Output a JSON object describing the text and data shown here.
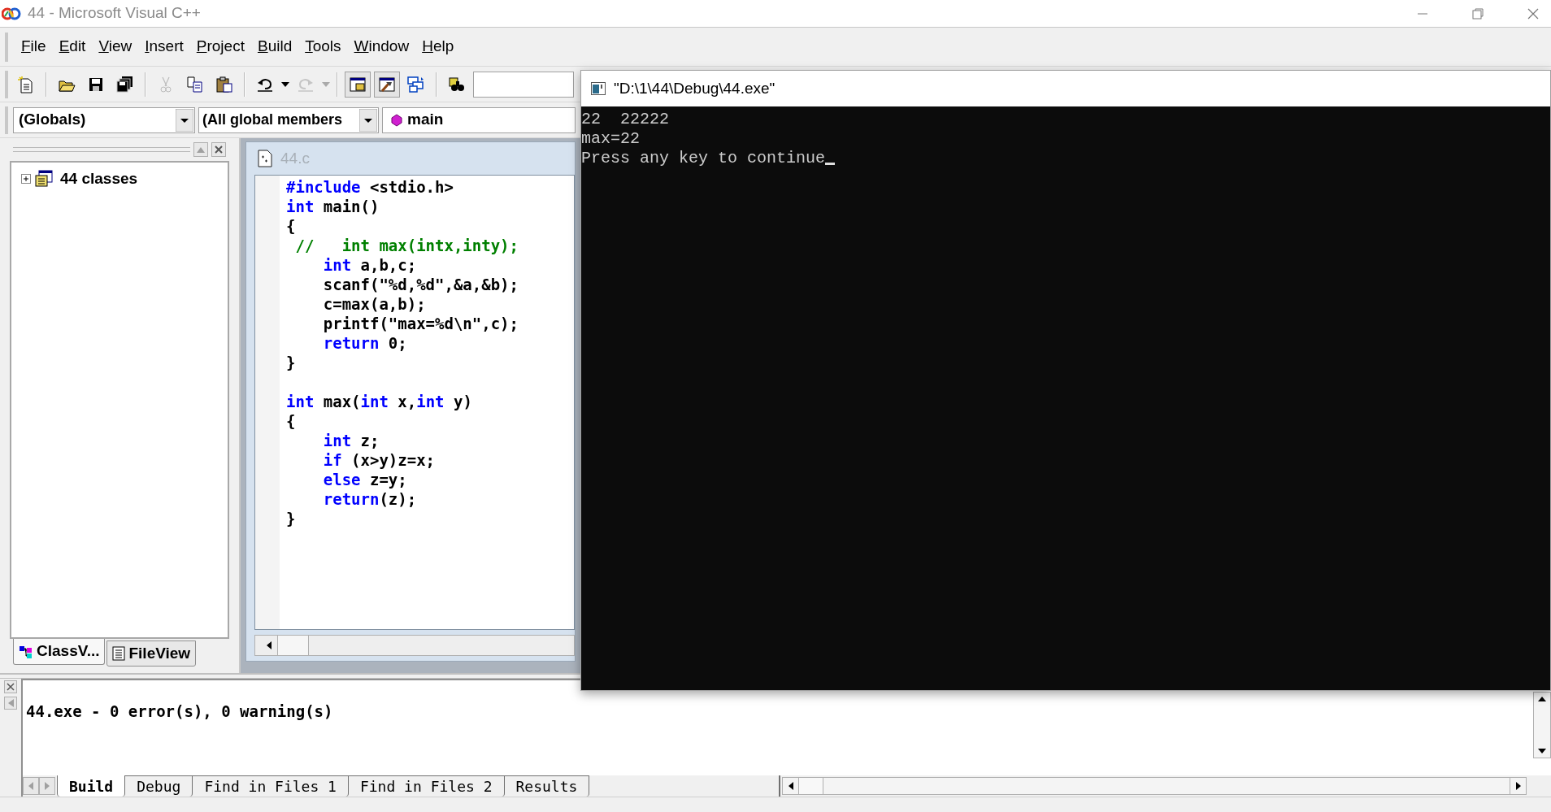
{
  "window": {
    "title": "44 - Microsoft Visual C++"
  },
  "menu": [
    {
      "label": "File"
    },
    {
      "label": "Edit"
    },
    {
      "label": "View"
    },
    {
      "label": "Insert"
    },
    {
      "label": "Project"
    },
    {
      "label": "Build"
    },
    {
      "label": "Tools"
    },
    {
      "label": "Window"
    },
    {
      "label": "Help"
    }
  ],
  "toolbar": [
    {
      "kind": "new",
      "disabled": false,
      "pressed": false
    },
    {
      "kind": "sep"
    },
    {
      "kind": "open",
      "disabled": false,
      "pressed": false
    },
    {
      "kind": "save",
      "disabled": false,
      "pressed": false
    },
    {
      "kind": "save_all",
      "disabled": false,
      "pressed": false
    },
    {
      "kind": "sep"
    },
    {
      "kind": "cut",
      "disabled": true,
      "pressed": false
    },
    {
      "kind": "copy",
      "disabled": false,
      "pressed": false
    },
    {
      "kind": "paste",
      "disabled": false,
      "pressed": false
    },
    {
      "kind": "sep"
    },
    {
      "kind": "undo",
      "disabled": false,
      "pressed": false
    },
    {
      "kind": "redo",
      "disabled": true,
      "pressed": false
    },
    {
      "kind": "sep"
    },
    {
      "kind": "workspace",
      "disabled": false,
      "pressed": true
    },
    {
      "kind": "output",
      "disabled": false,
      "pressed": true
    },
    {
      "kind": "windows",
      "disabled": false,
      "pressed": false
    },
    {
      "kind": "sep"
    },
    {
      "kind": "find",
      "disabled": false,
      "pressed": false
    }
  ],
  "combos": {
    "class": "(Globals)",
    "filter": "(All global members",
    "member": "main"
  },
  "workspace": {
    "tree": [
      {
        "label": "44 classes",
        "expanded": false
      }
    ],
    "tabs": [
      {
        "label": "ClassV...",
        "kind": "classview",
        "selected": true
      },
      {
        "label": "FileView",
        "kind": "fileview",
        "selected": false
      }
    ]
  },
  "editor": {
    "title": "44.c",
    "lines": [
      {
        "kind": "code",
        "segments": [
          {
            "text": "#include",
            "kind": "keyword"
          },
          {
            "text": " <stdio.h>",
            "kind": "text"
          }
        ]
      },
      {
        "kind": "code",
        "segments": [
          {
            "text": "int",
            "kind": "keyword"
          },
          {
            "text": " main()",
            "kind": "text"
          }
        ]
      },
      {
        "kind": "code",
        "segments": [
          {
            "text": "{",
            "kind": "text"
          }
        ]
      },
      {
        "kind": "code",
        "segments": [
          {
            "text": " //   int max(intx,inty);",
            "kind": "comment"
          }
        ]
      },
      {
        "kind": "code",
        "segments": [
          {
            "text": "    int",
            "kind": "keyword"
          },
          {
            "text": " a,b,c;",
            "kind": "text"
          }
        ]
      },
      {
        "kind": "code",
        "segments": [
          {
            "text": "    scanf(\"%d,%d\",&a,&b);",
            "kind": "text"
          }
        ]
      },
      {
        "kind": "code",
        "segments": [
          {
            "text": "    c=max(a,b);",
            "kind": "text"
          }
        ]
      },
      {
        "kind": "code",
        "segments": [
          {
            "text": "    printf(\"max=%d\\n\",c);",
            "kind": "text"
          }
        ]
      },
      {
        "kind": "code",
        "segments": [
          {
            "text": "    return",
            "kind": "keyword"
          },
          {
            "text": " 0;",
            "kind": "text"
          }
        ]
      },
      {
        "kind": "code",
        "segments": [
          {
            "text": "}",
            "kind": "text"
          }
        ]
      },
      {
        "kind": "blank"
      },
      {
        "kind": "code",
        "segments": [
          {
            "text": "int",
            "kind": "keyword"
          },
          {
            "text": " max(",
            "kind": "text"
          },
          {
            "text": "int",
            "kind": "keyword"
          },
          {
            "text": " x,",
            "kind": "text"
          },
          {
            "text": "int",
            "kind": "keyword"
          },
          {
            "text": " y)",
            "kind": "text"
          }
        ]
      },
      {
        "kind": "code",
        "segments": [
          {
            "text": "{",
            "kind": "text"
          }
        ]
      },
      {
        "kind": "code",
        "segments": [
          {
            "text": "    int",
            "kind": "keyword"
          },
          {
            "text": " z;",
            "kind": "text"
          }
        ]
      },
      {
        "kind": "code",
        "segments": [
          {
            "text": "    if",
            "kind": "keyword"
          },
          {
            "text": " (x>y)z=x;",
            "kind": "text"
          }
        ]
      },
      {
        "kind": "code",
        "segments": [
          {
            "text": "    else",
            "kind": "keyword"
          },
          {
            "text": " z=y;",
            "kind": "text"
          }
        ]
      },
      {
        "kind": "code",
        "segments": [
          {
            "text": "    return",
            "kind": "keyword"
          },
          {
            "text": "(z);",
            "kind": "text"
          }
        ]
      },
      {
        "kind": "code",
        "segments": [
          {
            "text": "}",
            "kind": "text"
          }
        ]
      }
    ]
  },
  "console": {
    "title": "\"D:\\1\\44\\Debug\\44.exe\"",
    "lines": [
      "22  22222",
      "max=22",
      "Press any key to continue"
    ]
  },
  "output": {
    "lines": [
      "44.exe - 0 error(s), 0 warning(s)"
    ],
    "tabs": [
      {
        "label": "Build",
        "selected": true
      },
      {
        "label": "Debug",
        "selected": false
      },
      {
        "label": "Find in Files 1",
        "selected": false
      },
      {
        "label": "Find in Files 2",
        "selected": false
      },
      {
        "label": "Results",
        "selected": false
      }
    ]
  }
}
